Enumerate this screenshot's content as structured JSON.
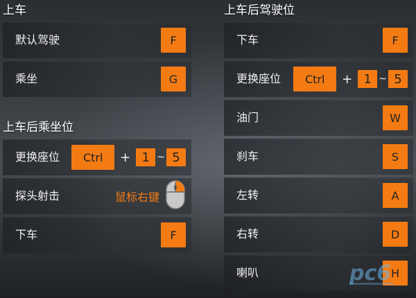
{
  "left": {
    "sections": [
      {
        "title": "上车",
        "rows": [
          {
            "label": "默认驾驶",
            "keys": [
              "F"
            ]
          },
          {
            "label": "乘坐",
            "keys": [
              "G"
            ]
          }
        ]
      },
      {
        "title": "上车后乘坐位",
        "rows": [
          {
            "label": "更换座位",
            "keys": [
              "Ctrl",
              "+",
              "1",
              "~",
              "5"
            ]
          },
          {
            "label": "探头射击",
            "mouse_text": "鼠标右键",
            "icon": "mouse-right-button-icon"
          },
          {
            "label": "下车",
            "keys": [
              "F"
            ]
          }
        ]
      }
    ]
  },
  "right": {
    "sections": [
      {
        "title": "上车后驾驶位",
        "rows": [
          {
            "label": "下车",
            "keys": [
              "F"
            ]
          },
          {
            "label": "更换座位",
            "keys": [
              "Ctrl",
              "+",
              "1",
              "~",
              "5"
            ]
          },
          {
            "label": "油门",
            "keys": [
              "W"
            ]
          },
          {
            "label": "刹车",
            "keys": [
              "S"
            ]
          },
          {
            "label": "左转",
            "keys": [
              "A"
            ]
          },
          {
            "label": "右转",
            "keys": [
              "D"
            ]
          },
          {
            "label": "喇叭",
            "keys": [
              "H"
            ]
          }
        ]
      }
    ]
  },
  "colors": {
    "key": "#f47b13",
    "text": "#f2f2f2",
    "mouse_text": "#f47b13"
  },
  "watermark": "pc6"
}
